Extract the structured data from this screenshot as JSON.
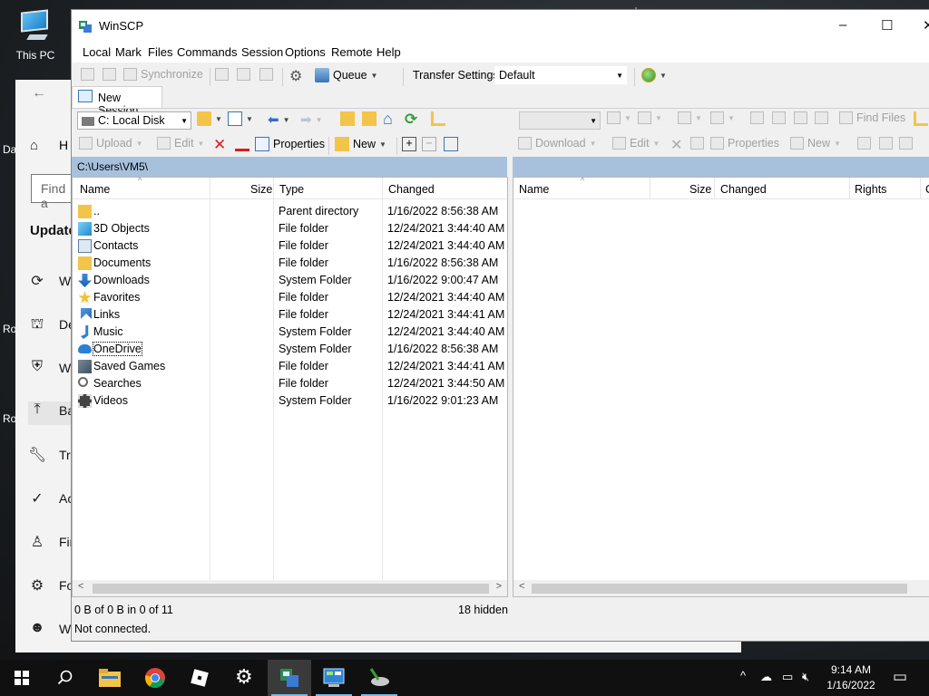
{
  "desktop": {
    "this_pc_label": "This PC",
    "edge_labels": [
      "Da",
      "Ro",
      "Ro"
    ]
  },
  "settings": {
    "back_icon": "back-arrow-icon",
    "home_label": "H",
    "find_placeholder": "Find a",
    "section_title": "Update",
    "items": [
      {
        "icon": "sync-icon",
        "label": "W",
        "selected": false
      },
      {
        "icon": "delivery-icon",
        "label": "De",
        "selected": false
      },
      {
        "icon": "shield-icon",
        "label": "W",
        "selected": false
      },
      {
        "icon": "backup-icon",
        "label": "Ba",
        "selected": true
      },
      {
        "icon": "wrench-icon",
        "label": "Tr",
        "selected": false
      },
      {
        "icon": "check-circle-icon",
        "label": "Ac",
        "selected": false
      },
      {
        "icon": "person-icon",
        "label": "Fir",
        "selected": false
      },
      {
        "icon": "sliders-icon",
        "label": "Fo",
        "selected": false
      },
      {
        "icon": "cat-icon",
        "label": "W",
        "selected": false
      }
    ]
  },
  "window": {
    "title": "WinSCP",
    "controls": {
      "minimize": "–",
      "maximize": "☐",
      "close": "✕"
    }
  },
  "menubar": [
    "Local",
    "Mark",
    "Files",
    "Commands",
    "Session",
    "Options",
    "Remote",
    "Help"
  ],
  "toolbar1": {
    "synchronize": "Synchronize",
    "queue": "Queue",
    "transfer_settings_label": "Transfer Settings",
    "transfer_settings_value": "Default"
  },
  "session_tab": {
    "label": "New Session"
  },
  "local": {
    "drive": "C: Local Disk",
    "path": "C:\\Users\\VM5\\",
    "actions": {
      "upload": "Upload",
      "edit": "Edit",
      "properties": "Properties",
      "new": "New"
    },
    "columns": {
      "name": "Name",
      "size": "Size",
      "type": "Type",
      "changed": "Changed"
    },
    "files": [
      {
        "name": "..",
        "size": "",
        "type": "Parent directory",
        "changed": "1/16/2022  8:56:38 AM",
        "icon": "parent-dir-icon"
      },
      {
        "name": "3D Objects",
        "size": "",
        "type": "File folder",
        "changed": "12/24/2021  3:44:40 AM",
        "icon": "3d-objects-icon"
      },
      {
        "name": "Contacts",
        "size": "",
        "type": "File folder",
        "changed": "12/24/2021  3:44:40 AM",
        "icon": "contacts-icon"
      },
      {
        "name": "Documents",
        "size": "",
        "type": "File folder",
        "changed": "1/16/2022  8:56:38 AM",
        "icon": "folder-icon"
      },
      {
        "name": "Downloads",
        "size": "",
        "type": "System Folder",
        "changed": "1/16/2022  9:00:47 AM",
        "icon": "download-icon"
      },
      {
        "name": "Favorites",
        "size": "",
        "type": "File folder",
        "changed": "12/24/2021  3:44:40 AM",
        "icon": "star-icon"
      },
      {
        "name": "Links",
        "size": "",
        "type": "File folder",
        "changed": "12/24/2021  3:44:41 AM",
        "icon": "link-icon"
      },
      {
        "name": "Music",
        "size": "",
        "type": "System Folder",
        "changed": "12/24/2021  3:44:40 AM",
        "icon": "music-icon"
      },
      {
        "name": "OneDrive",
        "size": "",
        "type": "System Folder",
        "changed": "1/16/2022  8:56:38 AM",
        "icon": "cloud-icon"
      },
      {
        "name": "Saved Games",
        "size": "",
        "type": "File folder",
        "changed": "12/24/2021  3:44:41 AM",
        "icon": "games-icon"
      },
      {
        "name": "Searches",
        "size": "",
        "type": "File folder",
        "changed": "12/24/2021  3:44:50 AM",
        "icon": "search-icon"
      },
      {
        "name": "Videos",
        "size": "",
        "type": "System Folder",
        "changed": "1/16/2022  9:01:23 AM",
        "icon": "video-icon"
      }
    ]
  },
  "remote": {
    "find_files": "Find Files",
    "actions": {
      "download": "Download",
      "edit": "Edit",
      "properties": "Properties",
      "new": "New"
    },
    "columns": {
      "name": "Name",
      "size": "Size",
      "changed": "Changed",
      "rights": "Rights",
      "owner": "C"
    }
  },
  "status": {
    "selection": "0 B of 0 B in 0 of 11",
    "hidden": "18 hidden",
    "connection": "Not connected."
  },
  "taskbar": {
    "apps": [
      "start-icon",
      "search-icon",
      "file-explorer-icon",
      "chrome-icon",
      "roblox-icon",
      "settings-icon",
      "winscp-icon",
      "control-panel-icon",
      "disk-cleanup-icon"
    ],
    "clock_time": "9:14 AM",
    "clock_date": "1/16/2022"
  },
  "colors": {
    "path_bar": "#a7c1dc",
    "taskbar": "#101010",
    "accent": "#0078d7"
  }
}
